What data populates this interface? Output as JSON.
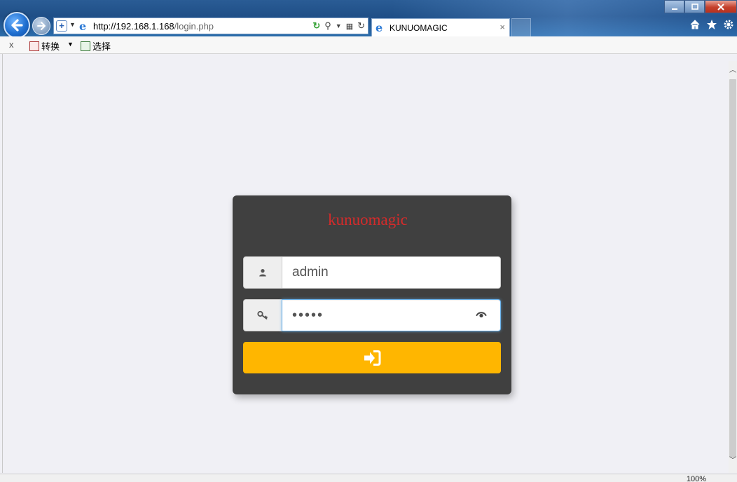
{
  "browser": {
    "url_host": "http://192.168.1.168",
    "url_path": "/login.php",
    "tab_title": "KUNUOMAGIC",
    "tab_close": "×",
    "zoom": "100%"
  },
  "command_bar": {
    "close": "x",
    "convert_label": "转换",
    "select_label": "选择"
  },
  "login": {
    "brand": "kunuomagic",
    "username_value": "admin",
    "password_value": "•••••"
  },
  "colors": {
    "card_bg": "#404040",
    "brand_red": "#d42b2b",
    "button_yellow": "#ffb600",
    "page_bg": "#f0f0f5"
  },
  "icons": {
    "username": "user-icon",
    "password": "key-icon",
    "toggle_password": "eye-icon",
    "submit": "sign-in-icon"
  }
}
